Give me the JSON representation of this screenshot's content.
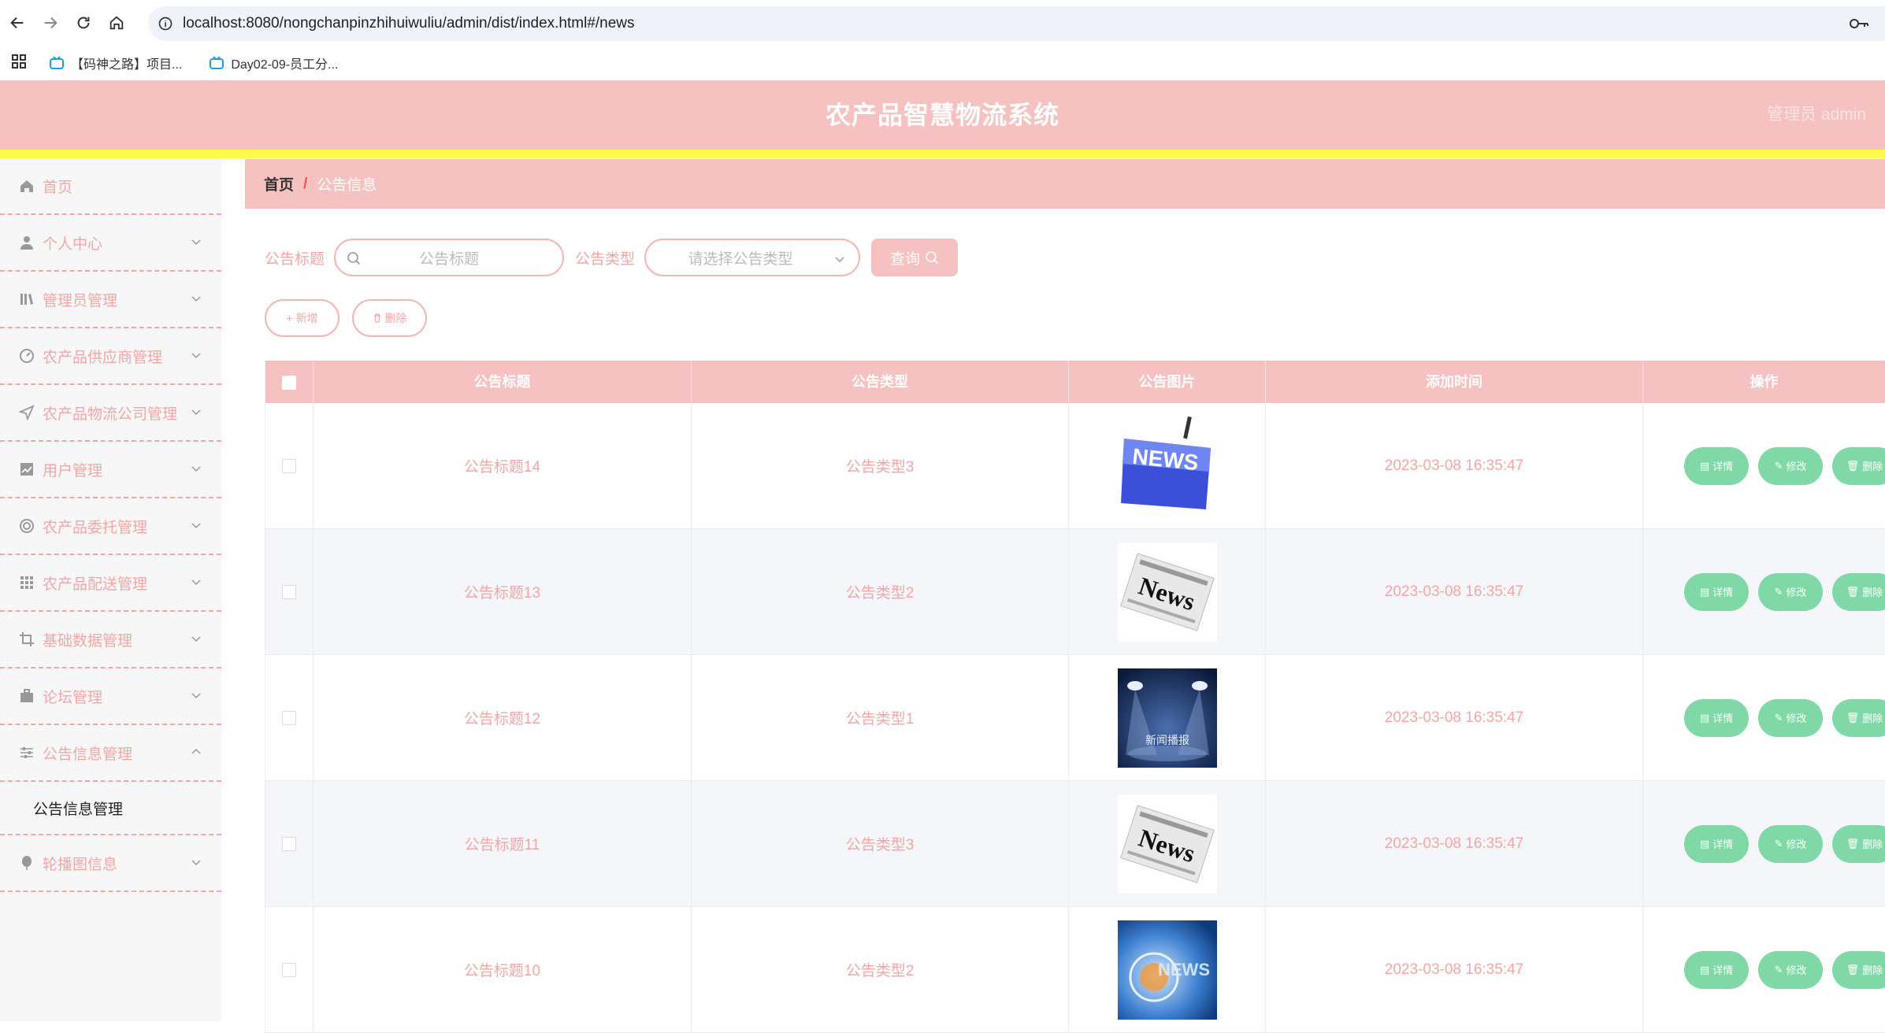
{
  "browser": {
    "url": "localhost:8080/nongchanpinzhihuiwuliu/admin/dist/index.html#/news",
    "bookmarks": [
      "【码神之路】项目...",
      "Day02-09-员工分..."
    ]
  },
  "header": {
    "title": "农产品智慧物流系统",
    "admin_label": "管理员 admin"
  },
  "sidebar": {
    "items": [
      {
        "label": "首页",
        "icon": "home-icon",
        "has_chevron": false
      },
      {
        "label": "个人中心",
        "icon": "user-icon",
        "has_chevron": true
      },
      {
        "label": "管理员管理",
        "icon": "library-icon",
        "has_chevron": true
      },
      {
        "label": "农产品供应商管理",
        "icon": "gauge-icon",
        "has_chevron": true
      },
      {
        "label": "农产品物流公司管理",
        "icon": "send-icon",
        "has_chevron": true
      },
      {
        "label": "用户管理",
        "icon": "chart-icon",
        "has_chevron": true
      },
      {
        "label": "农产品委托管理",
        "icon": "lifebuoy-icon",
        "has_chevron": true
      },
      {
        "label": "农产品配送管理",
        "icon": "grid-icon",
        "has_chevron": true
      },
      {
        "label": "基础数据管理",
        "icon": "crop-icon",
        "has_chevron": true
      },
      {
        "label": "论坛管理",
        "icon": "briefcase-icon",
        "has_chevron": true
      },
      {
        "label": "公告信息管理",
        "icon": "sliders-icon",
        "has_chevron": true,
        "expanded": true
      },
      {
        "label": "轮播图信息",
        "icon": "balloon-icon",
        "has_chevron": true
      }
    ],
    "submenu_label": "公告信息管理"
  },
  "breadcrumb": {
    "home": "首页",
    "separator": "/",
    "current": "公告信息"
  },
  "search": {
    "title_label": "公告标题",
    "title_placeholder": "公告标题",
    "type_label": "公告类型",
    "type_placeholder": "请选择公告类型",
    "query_label": "查询"
  },
  "actions": {
    "add_label": "新增",
    "delete_label": "删除"
  },
  "table": {
    "columns": [
      "公告标题",
      "公告类型",
      "公告图片",
      "添加时间",
      "操作"
    ],
    "rows": [
      {
        "title": "公告标题14",
        "type": "公告类型3",
        "image": "news-key",
        "time": "2023-03-08 16:35:47"
      },
      {
        "title": "公告标题13",
        "type": "公告类型2",
        "image": "news-paper",
        "time": "2023-03-08 16:35:47"
      },
      {
        "title": "公告标题12",
        "type": "公告类型1",
        "image": "news-stage",
        "time": "2023-03-08 16:35:47"
      },
      {
        "title": "公告标题11",
        "type": "公告类型3",
        "image": "news-paper",
        "time": "2023-03-08 16:35:47"
      },
      {
        "title": "公告标题10",
        "type": "公告类型2",
        "image": "news-globe",
        "time": "2023-03-08 16:35:47"
      }
    ],
    "op_labels": {
      "detail": "详情",
      "edit": "修改",
      "delete": "删除"
    },
    "image_texts": {
      "key": "NEWS",
      "paper": "News",
      "stage": "新闻播报",
      "globe": "NEWS"
    }
  },
  "colors": {
    "header_pink": "#f6c1c1",
    "accent_pink": "#f2a6a6",
    "yellow": "#fffb4d",
    "green": "#7fd8a6"
  }
}
